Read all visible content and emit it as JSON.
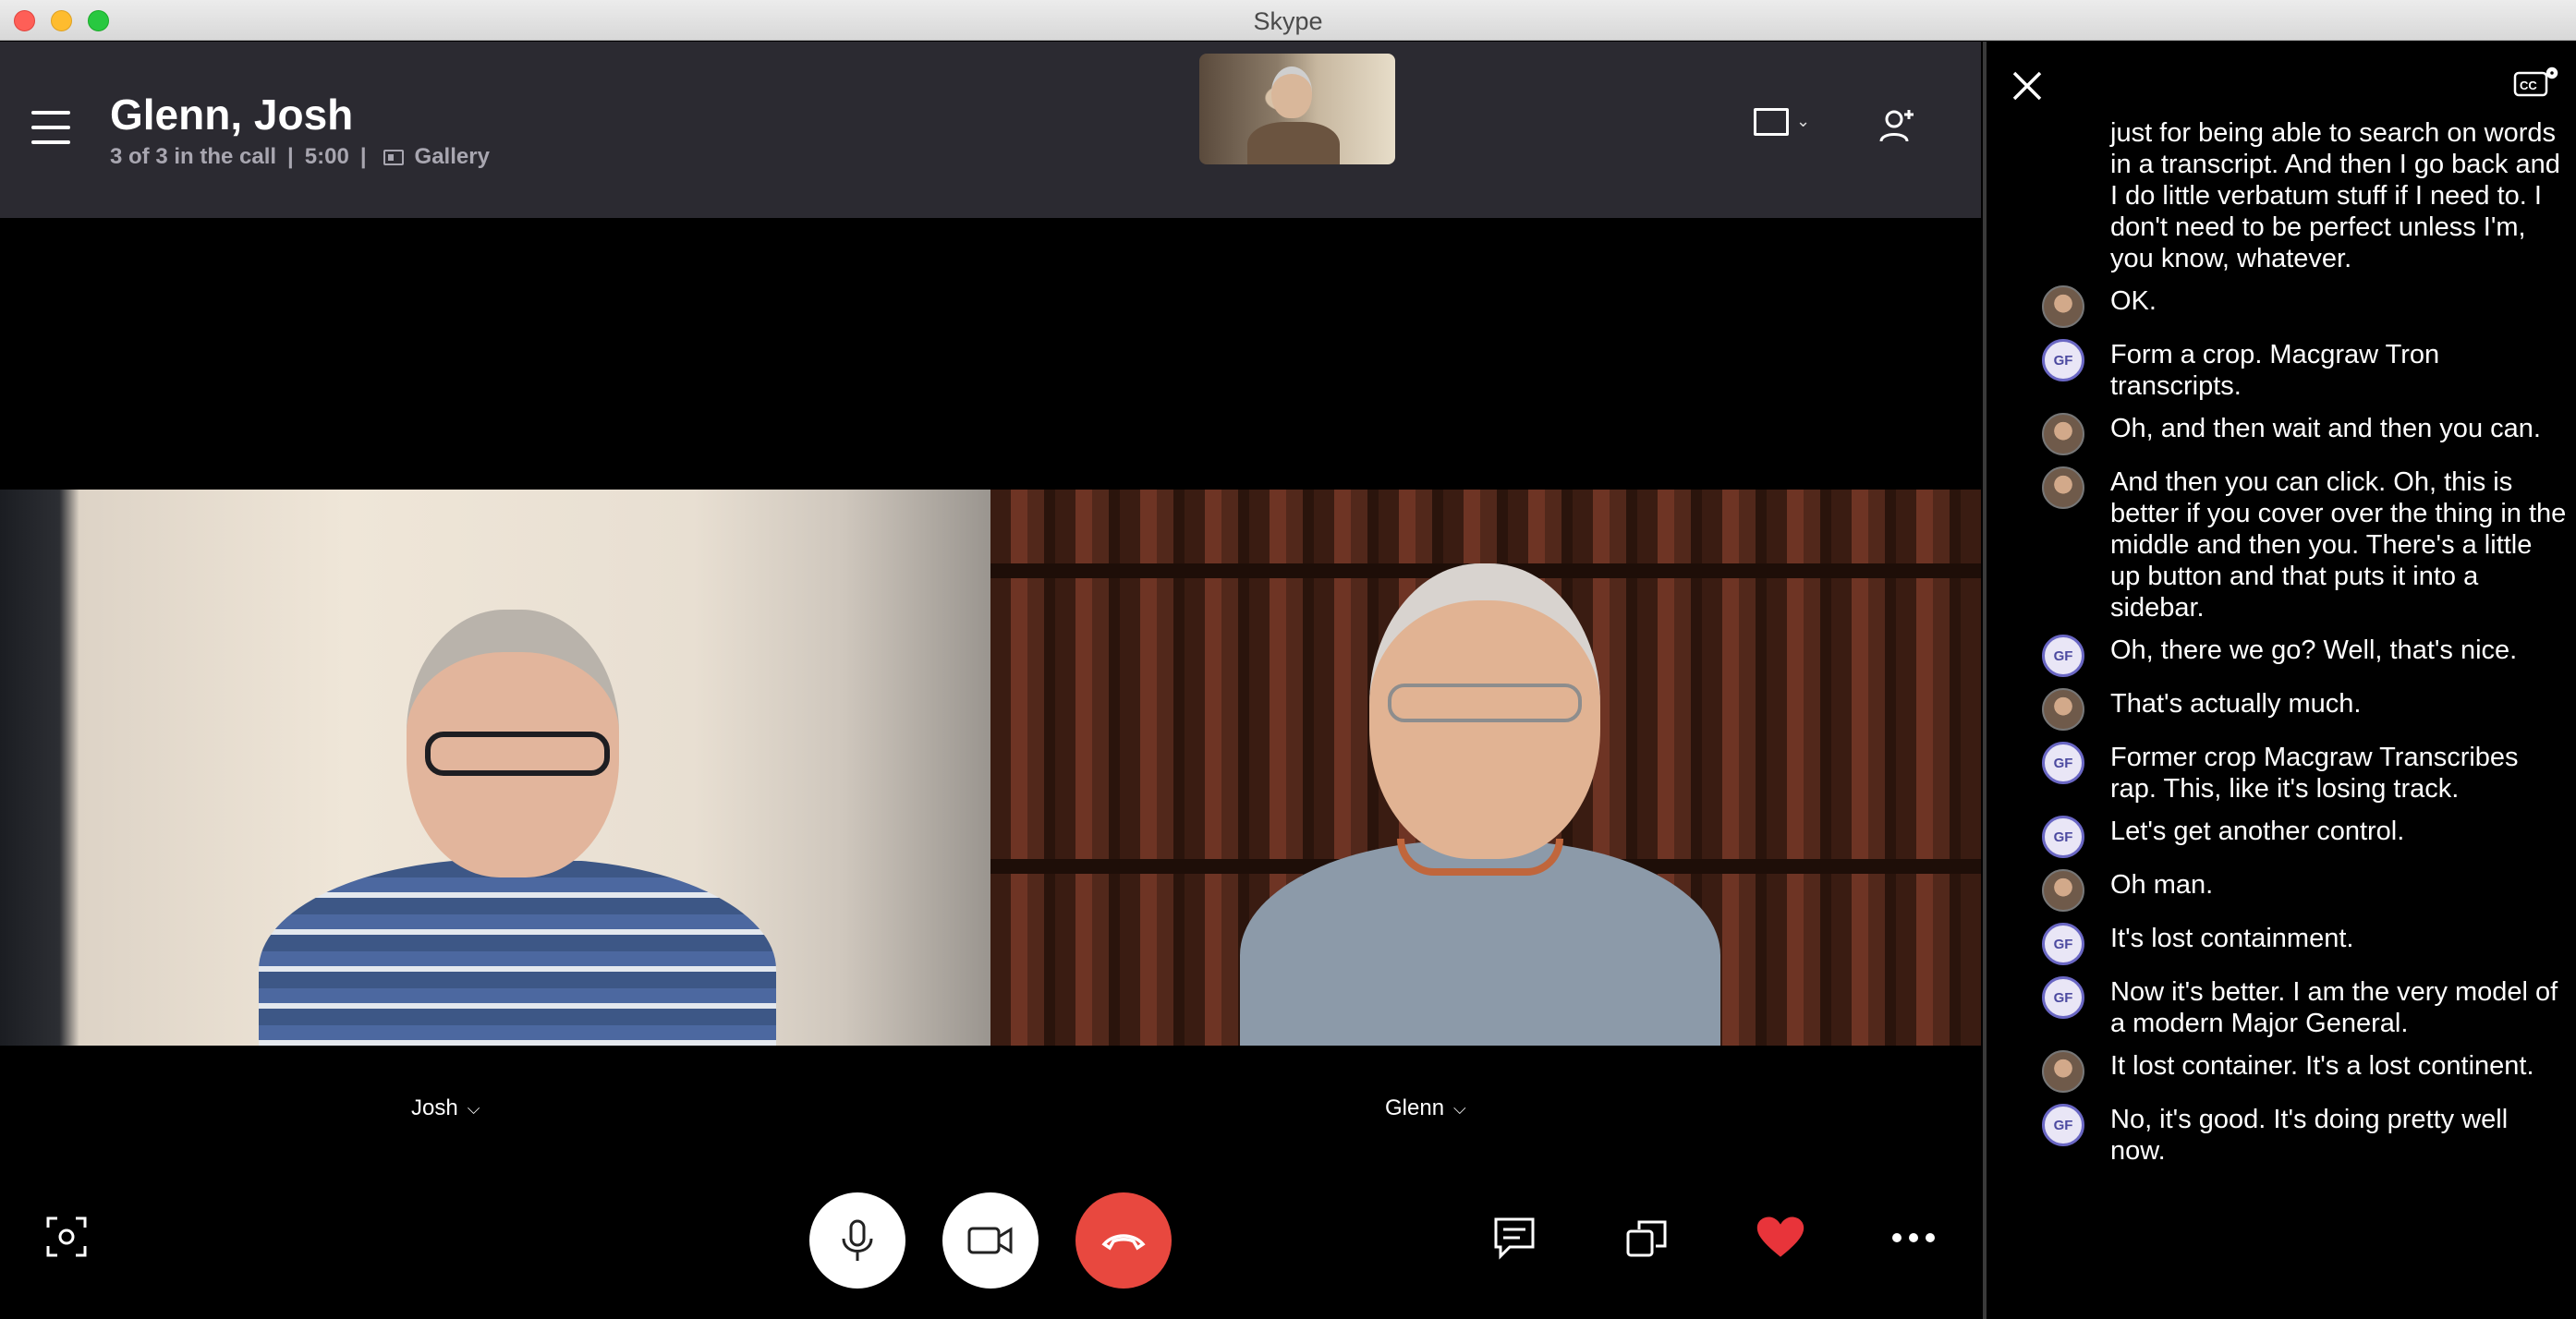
{
  "window": {
    "title": "Skype"
  },
  "call": {
    "title": "Glenn, Josh",
    "participants_status": "3 of 3 in the call",
    "separator": "|",
    "duration": "5:00",
    "view_mode": "Gallery"
  },
  "tiles": [
    {
      "name": "Josh"
    },
    {
      "name": "Glenn"
    }
  ],
  "captions": {
    "rows": [
      {
        "speaker": "none",
        "text": "just for being able to search on words in a transcript. And then I go back and I do little verbatum stuff if I need to. I don't need to be perfect unless I'm, you know, whatever."
      },
      {
        "speaker": "photo",
        "text": "OK."
      },
      {
        "speaker": "GF",
        "text": "Form a crop. Macgraw Tron transcripts."
      },
      {
        "speaker": "photo",
        "text": "Oh, and then wait and then you can."
      },
      {
        "speaker": "photo",
        "text": "And then you can click. Oh, this is better if you cover over the thing in the middle and then you. There's a little up button and that puts it into a sidebar."
      },
      {
        "speaker": "GF",
        "text": "Oh, there we go? Well, that's nice."
      },
      {
        "speaker": "photo",
        "text": "That's actually much."
      },
      {
        "speaker": "GF",
        "text": "Former crop Macgraw Transcribes rap. This, like it's losing track."
      },
      {
        "speaker": "GF",
        "text": "Let's get another control."
      },
      {
        "speaker": "photo",
        "text": "Oh man."
      },
      {
        "speaker": "GF",
        "text": "It's lost containment."
      },
      {
        "speaker": "GF",
        "text": "Now it's better. I am the very model of a modern Major General."
      },
      {
        "speaker": "photo",
        "text": "It lost container. It's a lost continent."
      },
      {
        "speaker": "GF",
        "text": "No, it's good. It's doing pretty well now."
      }
    ]
  },
  "colors": {
    "header_bg": "#2b2a31",
    "end_call": "#e8483f",
    "heart": "#e8343a",
    "gf_avatar_ring": "#6a67c4"
  },
  "icons": [
    "menu-icon",
    "gallery-icon",
    "layout-icon",
    "add-person-icon",
    "screenshot-icon",
    "microphone-icon",
    "video-camera-icon",
    "end-call-icon",
    "chat-icon",
    "share-screen-icon",
    "heart-icon",
    "more-icon",
    "close-icon",
    "closed-captions-settings-icon"
  ]
}
